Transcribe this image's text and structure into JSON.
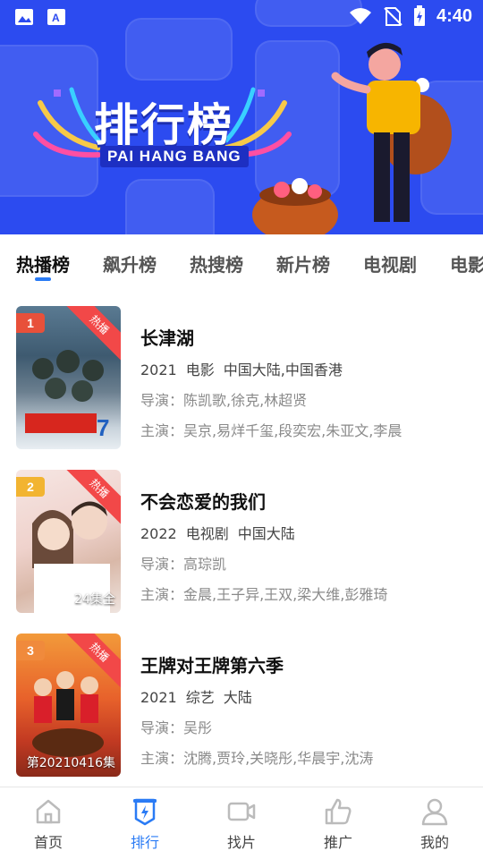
{
  "status_bar": {
    "time": "4:40"
  },
  "banner": {
    "title": "排行榜",
    "subtitle": "PAI HANG BANG"
  },
  "tabs": [
    {
      "label": "热播榜",
      "active": true
    },
    {
      "label": "飙升榜",
      "active": false
    },
    {
      "label": "热搜榜",
      "active": false
    },
    {
      "label": "新片榜",
      "active": false
    },
    {
      "label": "电视剧",
      "active": false
    },
    {
      "label": "电影",
      "active": false
    }
  ],
  "items": [
    {
      "rank": "1",
      "badge": "热播",
      "episodes": "",
      "title": "长津湖",
      "year": "2021",
      "type": "电影",
      "region": "中国大陆,中国香港",
      "director": "导演：陈凯歌,徐克,林超贤",
      "cast": "主演：吴京,易烊千玺,段奕宏,朱亚文,李晨"
    },
    {
      "rank": "2",
      "badge": "热播",
      "episodes": "24集全",
      "title": "不会恋爱的我们",
      "year": "2022",
      "type": "电视剧",
      "region": "中国大陆",
      "director": "导演：高琮凯",
      "cast": "主演：金晨,王子异,王双,梁大维,彭雅琦"
    },
    {
      "rank": "3",
      "badge": "热播",
      "episodes": "第20210416集",
      "title": "王牌对王牌第六季",
      "year": "2021",
      "type": "综艺",
      "region": "大陆",
      "director": "导演：吴彤",
      "cast": "主演：沈腾,贾玲,关晓彤,华晨宇,沈涛"
    }
  ],
  "bottom_nav": [
    {
      "label": "首页",
      "icon": "home-icon",
      "active": false
    },
    {
      "label": "排行",
      "icon": "ranking-icon",
      "active": true
    },
    {
      "label": "找片",
      "icon": "video-icon",
      "active": false
    },
    {
      "label": "推广",
      "icon": "thumbs-up-icon",
      "active": false
    },
    {
      "label": "我的",
      "icon": "user-icon",
      "active": false
    }
  ],
  "colors": {
    "accent": "#2a7bf5",
    "banner": "#2c4bf0",
    "badge": "#f24848",
    "rank1": "#e8503a",
    "rank2": "#f2b431",
    "rank3": "#f08a3c"
  }
}
